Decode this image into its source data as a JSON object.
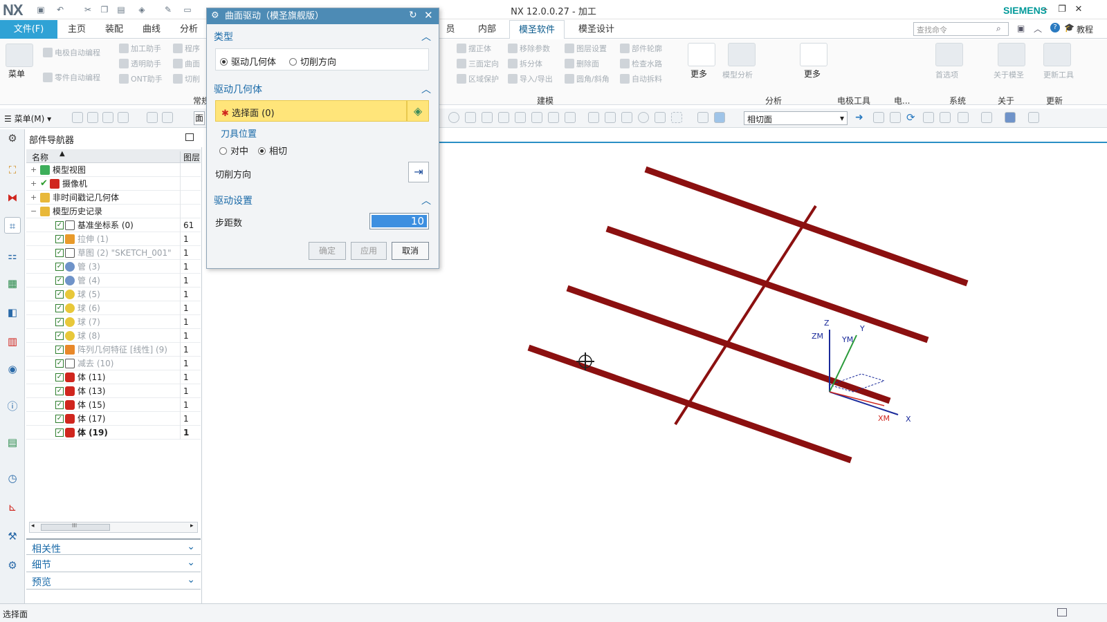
{
  "app": {
    "logo": "NX",
    "window_title": "NX 12.0.0.27 - 加工",
    "brand": "SIEMENS",
    "window_buttons": [
      "–",
      "❐",
      "✕"
    ]
  },
  "menubar": {
    "file_label": "文件(F)",
    "tabs": [
      "主页",
      "装配",
      "曲线",
      "分析",
      "员",
      "内部",
      "模圣软件",
      "模圣设计"
    ],
    "active_tab": "模圣软件",
    "search_placeholder": "查找命令",
    "tutorial_label": "教程"
  },
  "ribbon": {
    "menu_label": "菜单",
    "left_tools": [
      "电极自动编程",
      "加工助手",
      "程序",
      "透明助手",
      "曲面",
      "零件自动编程",
      "ONT助手",
      "切削"
    ],
    "common_group": "常规",
    "model_tools": [
      "摆正体",
      "移除参数",
      "图层设置",
      "部件轮廓",
      "三面定向",
      "拆分体",
      "删除面",
      "检查水路",
      "区域保护",
      "导入/导出",
      "圆角/斜角",
      "自动拆料"
    ],
    "more_label": "更多",
    "analysis_tool": "模型分析",
    "first_pref": "首选项",
    "about_label": "关于模圣",
    "update_label": "更新工具",
    "groups": [
      "建模",
      "分析",
      "电极工具",
      "电...",
      "系统",
      "关于",
      "更新"
    ]
  },
  "toolbar2": {
    "menu_label": "菜单(M)",
    "face_label": "面",
    "filter_value": "相切面"
  },
  "navigator": {
    "title": "部件导航器",
    "col_name": "名称",
    "col_layer": "图层",
    "rows": [
      {
        "label": "模型视图",
        "layer": ""
      },
      {
        "label": "摄像机",
        "layer": ""
      },
      {
        "label": "非时间戳记几何体",
        "layer": ""
      },
      {
        "label": "模型历史记录",
        "layer": ""
      },
      {
        "label": "基准坐标系 (0)",
        "layer": "61"
      },
      {
        "label": "拉伸 (1)",
        "layer": "1"
      },
      {
        "label": "草图 (2) \"SKETCH_001\"",
        "layer": "1"
      },
      {
        "label": "管 (3)",
        "layer": "1"
      },
      {
        "label": "管 (4)",
        "layer": "1"
      },
      {
        "label": "球 (5)",
        "layer": "1"
      },
      {
        "label": "球 (6)",
        "layer": "1"
      },
      {
        "label": "球 (7)",
        "layer": "1"
      },
      {
        "label": "球 (8)",
        "layer": "1"
      },
      {
        "label": "阵列几何特征 [线性] (9)",
        "layer": "1"
      },
      {
        "label": "减去 (10)",
        "layer": "1"
      },
      {
        "label": "体 (11)",
        "layer": "1"
      },
      {
        "label": "体 (13)",
        "layer": "1"
      },
      {
        "label": "体 (15)",
        "layer": "1"
      },
      {
        "label": "体 (17)",
        "layer": "1"
      },
      {
        "label": "体 (19)",
        "layer": "1"
      }
    ],
    "scroll_grip": "III",
    "accordions": [
      "相关性",
      "细节",
      "预览"
    ]
  },
  "dialog": {
    "title": "曲面驱动（模圣旗舰版）",
    "type_section": "类型",
    "type_options": [
      "驱动几何体",
      "切削方向"
    ],
    "type_selected": "驱动几何体",
    "drive_section": "驱动几何体",
    "select_face": "选择面 (0)",
    "tool_position": "刀具位置",
    "tool_options": [
      "对中",
      "相切"
    ],
    "tool_selected": "相切",
    "cut_direction": "切削方向",
    "settings_section": "驱动设置",
    "step_label": "步距数",
    "step_value": "10",
    "btn_ok": "确定",
    "btn_apply": "应用",
    "btn_cancel": "取消"
  },
  "viewport": {
    "axis_labels": [
      "Z",
      "ZM",
      "YM",
      "Y",
      "XM",
      "X"
    ],
    "beam_color": "#8b1010"
  },
  "status": {
    "text": "选择面"
  }
}
